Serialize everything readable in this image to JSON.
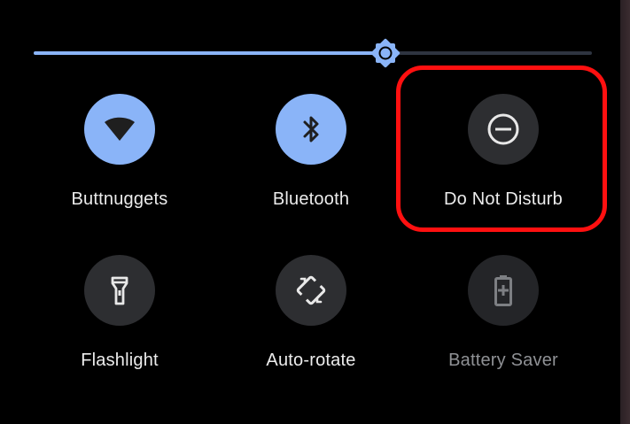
{
  "brightness": {
    "level": 0.63
  },
  "tiles": [
    {
      "id": "wifi",
      "label": "Buttnuggets",
      "icon": "wifi-icon",
      "state": "on"
    },
    {
      "id": "bluetooth",
      "label": "Bluetooth",
      "icon": "bluetooth-icon",
      "state": "on"
    },
    {
      "id": "dnd",
      "label": "Do Not Disturb",
      "icon": "do-not-disturb-icon",
      "state": "off"
    },
    {
      "id": "flashlight",
      "label": "Flashlight",
      "icon": "flashlight-icon",
      "state": "off"
    },
    {
      "id": "autorotate",
      "label": "Auto-rotate",
      "icon": "auto-rotate-icon",
      "state": "off"
    },
    {
      "id": "battery",
      "label": "Battery Saver",
      "icon": "battery-saver-icon",
      "state": "unavailable"
    }
  ],
  "colors": {
    "active_tile": "#8ab4f8",
    "inactive_tile": "#2d2e31",
    "highlight": "#ff1010",
    "background": "#000000"
  }
}
